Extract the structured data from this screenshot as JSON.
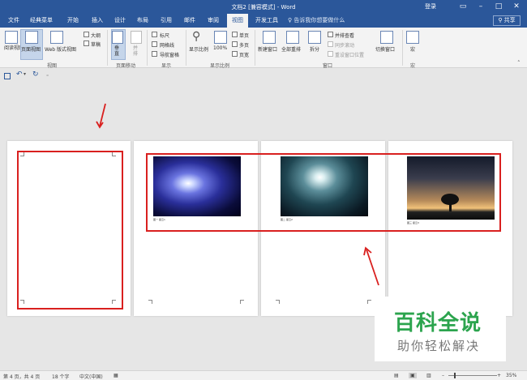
{
  "window": {
    "title": "文档2 [兼容模式] - Word",
    "login": "登录",
    "share": "共享"
  },
  "tabs": [
    "文件",
    "经典菜单",
    "开始",
    "插入",
    "设计",
    "布局",
    "引用",
    "邮件",
    "审阅",
    "视图",
    "开发工具"
  ],
  "active_tab": "视图",
  "tellme": "告诉我你想要做什么",
  "ribbon": {
    "views": {
      "read_mode": "阅读视图",
      "print_layout": "页面视图",
      "web_layout": "Web 版式视图",
      "outline": "大纲",
      "draft": "草稿",
      "group_label": "视图"
    },
    "page_movement": {
      "vertical": "垂直",
      "side_by_side": "并排",
      "group_label": "页面移动"
    },
    "show": {
      "ruler": "标尺",
      "gridlines": "网格线",
      "nav_pane": "导航窗格",
      "group_label": "显示"
    },
    "zoom": {
      "zoom": "显示比例",
      "hundred": "100%",
      "one_page": "单页",
      "multiple_pages": "多页",
      "page_width": "页宽",
      "group_label": "显示比例"
    },
    "window": {
      "new_window": "新建窗口",
      "arrange_all": "全部重排",
      "split": "拆分",
      "view_side_by_side": "并排查看",
      "sync_scroll": "同步滚动",
      "reset_position": "重设窗口位置",
      "switch_windows": "切换窗口",
      "group_label": "窗口"
    },
    "macros": {
      "macros": "宏",
      "group_label": "宏"
    }
  },
  "pages": [
    {
      "caption": ""
    },
    {
      "caption": "图一 星云1"
    },
    {
      "caption": "图二 星云2"
    },
    {
      "caption": "图三 星云3"
    }
  ],
  "watermark": {
    "title": "百科全说",
    "subtitle": "助你轻松解决"
  },
  "status": {
    "page": "第 4 页，共 4 页",
    "words": "18 个字",
    "language": "中文(中国)",
    "zoom": "35%"
  },
  "colors": {
    "accent": "#2b579a",
    "highlight_red": "#d9201f",
    "watermark_green": "#2ca44e"
  }
}
